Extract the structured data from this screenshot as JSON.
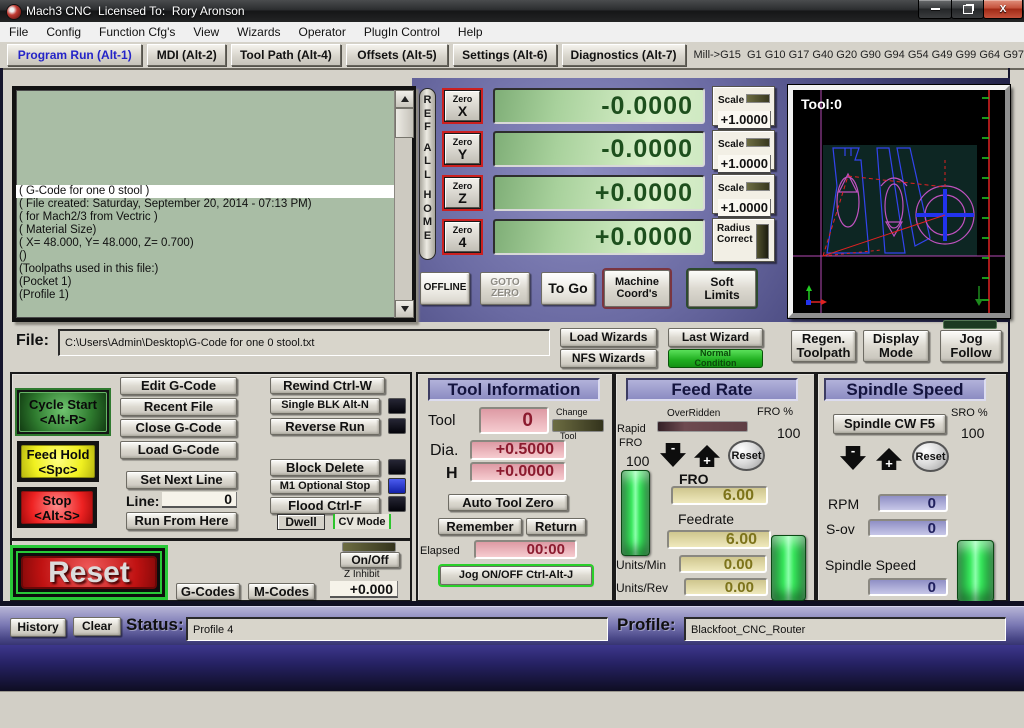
{
  "window": {
    "title": "Mach3 CNC  Licensed To:  Rory Aronson"
  },
  "menu": {
    "items": [
      "File",
      "Config",
      "Function Cfg's",
      "View",
      "Wizards",
      "Operator",
      "PlugIn Control",
      "Help"
    ]
  },
  "tabs": {
    "items": [
      "Program Run (Alt-1)",
      "MDI (Alt-2)",
      "Tool Path (Alt-4)",
      "Offsets (Alt-5)",
      "Settings (Alt-6)",
      "Diagnostics (Alt-7)"
    ],
    "modes": "Mill->G15  G1 G10 G17 G40 G20 G90 G94 G54 G49 G99 G64 G97"
  },
  "gcode": {
    "highlighted_line": "( G-Code for one 0 stool )",
    "lines": [
      "( File created: Saturday, September 20, 2014 - 07:13 PM)",
      "( for Mach2/3 from Vectric )",
      "( Material Size)",
      "( X= 48.000, Y= 48.000, Z= 0.700)",
      "()",
      "(Toolpaths used in this file:)",
      "(Pocket 1)",
      "(Profile 1)"
    ]
  },
  "dro": {
    "ref_all_home": [
      "R",
      "E",
      "F",
      "A",
      "L",
      "L",
      "H",
      "O",
      "M",
      "E"
    ],
    "axes": [
      {
        "zero": "Zero",
        "axis": "X",
        "value": "-0.0000",
        "scale_label": "Scale",
        "scale": "+1.0000"
      },
      {
        "zero": "Zero",
        "axis": "Y",
        "value": "-0.0000",
        "scale_label": "Scale",
        "scale": "+1.0000"
      },
      {
        "zero": "Zero",
        "axis": "Z",
        "value": "+0.0000",
        "scale_label": "Scale",
        "scale": "+1.0000"
      },
      {
        "zero": "Zero",
        "axis": "4",
        "value": "+0.0000"
      }
    ],
    "radius_correct": "Radius Correct",
    "offline": "OFFLINE",
    "goto_zero": "GOTO ZERO",
    "to_go": "To Go",
    "machine_coords": "Machine Coord's",
    "soft_limits": "Soft Limits"
  },
  "toolpath": {
    "tool_label": "Tool:0"
  },
  "file_bar": {
    "label": "File:",
    "path": "C:\\Users\\Admin\\Desktop\\G-Code for one 0 stool.txt"
  },
  "wizards": {
    "load": "Load Wizards",
    "last": "Last Wizard",
    "nfs": "NFS Wizards",
    "normal_condition": "Normal Condition"
  },
  "view_buttons": {
    "regen": "Regen. Toolpath",
    "display": "Display Mode",
    "jog": "Jog Follow"
  },
  "control": {
    "cycle_start_1": "Cycle Start",
    "cycle_start_2": "<Alt-R>",
    "feed_hold_1": "Feed Hold",
    "feed_hold_2": "<Spc>",
    "stop_1": "Stop",
    "stop_2": "<Alt-S>",
    "edit_gcode": "Edit G-Code",
    "recent_file": "Recent File",
    "close_gcode": "Close G-Code",
    "load_gcode": "Load G-Code",
    "set_next_line": "Set Next Line",
    "line_label": "Line:",
    "line_value": "0",
    "run_from_here": "Run From Here",
    "rewind": "Rewind Ctrl-W",
    "single_blk": "Single BLK Alt-N",
    "reverse_run": "Reverse Run",
    "block_delete": "Block Delete",
    "m1_optional_stop": "M1 Optional Stop",
    "flood": "Flood Ctrl-F",
    "dwell": "Dwell",
    "cv_mode": "CV Mode",
    "reset": "Reset",
    "g_codes": "G-Codes",
    "m_codes": "M-Codes",
    "on_off": "On/Off",
    "z_inhibit_label": "Z Inhibit",
    "z_inhibit_value": "+0.000"
  },
  "tool_info": {
    "title": "Tool Information",
    "tool_label": "Tool",
    "tool_value": "0",
    "change_label": "Change",
    "change_sub": "Tool",
    "dia_label": "Dia.",
    "dia_value": "+0.5000",
    "h_label": "H",
    "h_value": "+0.0000",
    "auto_tool_zero": "Auto Tool Zero",
    "remember": "Remember",
    "return": "Return",
    "elapsed_label": "Elapsed",
    "elapsed_value": "00:00",
    "jog_onoff": "Jog ON/OFF Ctrl-Alt-J"
  },
  "feed_rate": {
    "title": "Feed Rate",
    "overridden_label": "OverRidden",
    "fro_pct_label": "FRO %",
    "fro_pct_value": "100",
    "rapid_label": "Rapid",
    "rapid_label2": "FRO",
    "rapid_value": "100",
    "minus_glyph": "-",
    "plus_glyph": "+",
    "reset": "Reset",
    "fro_label": "FRO",
    "fro_value": "6.00",
    "feedrate_label": "Feedrate",
    "feedrate_value": "6.00",
    "units_min_label": "Units/Min",
    "units_min_value": "0.00",
    "units_rev_label": "Units/Rev",
    "units_rev_value": "0.00"
  },
  "spindle": {
    "title": "Spindle Speed",
    "cw_button": "Spindle CW F5",
    "sro_pct_label": "SRO %",
    "sro_pct_value": "100",
    "minus_glyph": "-",
    "plus_glyph": "+",
    "reset": "Reset",
    "rpm_label": "RPM",
    "rpm_value": "0",
    "sov_label": "S-ov",
    "sov_value": "0",
    "speed_label": "Spindle Speed",
    "speed_value": "0"
  },
  "status_bar": {
    "history": "History",
    "clear": "Clear",
    "status_label": "Status:",
    "status_value": "Profile 4",
    "profile_label": "Profile:",
    "profile_value": "Blackfoot_CNC_Router"
  },
  "colors": {
    "dro_green_text": "#1d4f1d",
    "lcd_pink_text": "#8c1b2f",
    "lcd_tan_text": "#7d741b",
    "lcd_purple_text": "#20205e",
    "selected_tab": "#2424c8",
    "slider_green": "#3ae85e",
    "reset_red": "#c01212"
  }
}
